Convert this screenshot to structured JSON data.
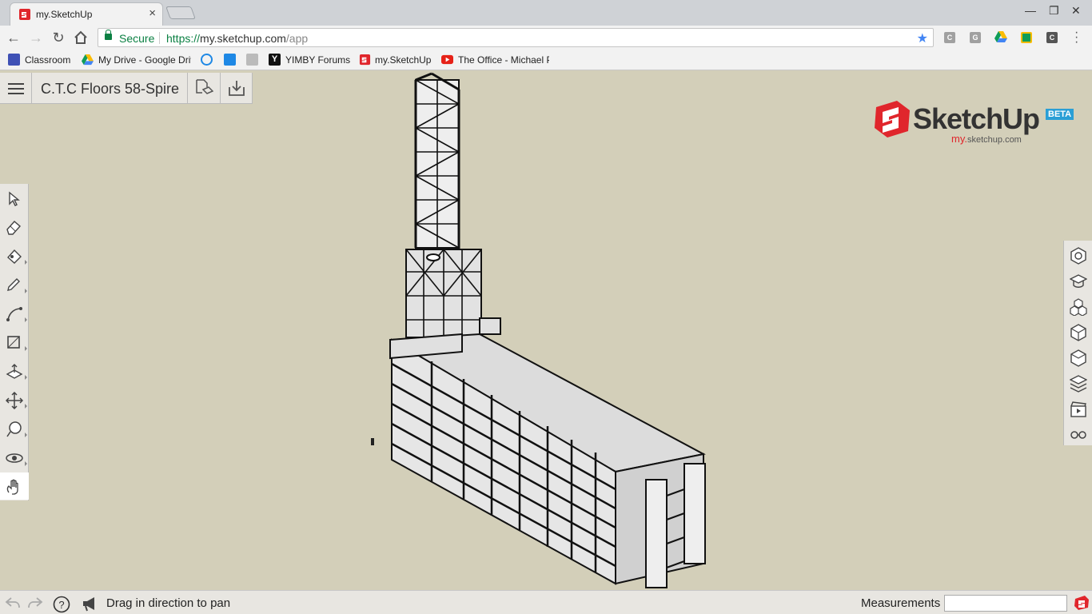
{
  "browser": {
    "tab_title": "my.SketchUp",
    "secure_label": "Secure",
    "url_protocol": "https://",
    "url_host": "my.sketchup.com",
    "url_path": "/app",
    "extensions": [
      "C",
      "G",
      "drive",
      "classroom",
      "C"
    ],
    "bookmarks": [
      {
        "label": "Classroom",
        "icon": "classroom-icon"
      },
      {
        "label": "My Drive - Google Driv",
        "icon": "drive-icon"
      },
      {
        "label": "",
        "icon": "edge-icon"
      },
      {
        "label": "",
        "icon": "blue-square-icon"
      },
      {
        "label": "",
        "icon": "yimby-img-icon"
      },
      {
        "label": "YIMBY Forums",
        "icon": "yimby-icon"
      },
      {
        "label": "my.SketchUp",
        "icon": "sketchup-icon"
      },
      {
        "label": "The Office - Michael P",
        "icon": "youtube-icon"
      }
    ]
  },
  "app": {
    "model_title": "C.T.C Floors 58-Spire",
    "logo_word": "SketchUp",
    "logo_beta": "BETA",
    "logo_sub_my": "my.",
    "logo_sub_rest": "sketchup.com",
    "left_tools": [
      "select-icon",
      "eraser-icon",
      "paint-bucket-icon",
      "pencil-icon",
      "arc-icon",
      "rectangle-icon",
      "push-pull-icon",
      "move-icon",
      "tape-measure-icon",
      "orbit-icon",
      "pan-icon"
    ],
    "active_tool": "pan-icon",
    "right_panels": [
      "entity-info-icon",
      "instructor-icon",
      "components-icon",
      "materials-icon",
      "styles-icon",
      "layers-icon",
      "scenes-icon",
      "display-icon"
    ]
  },
  "status": {
    "hint": "Drag in direction to pan",
    "measurements_label": "Measurements",
    "measurements_value": ""
  }
}
